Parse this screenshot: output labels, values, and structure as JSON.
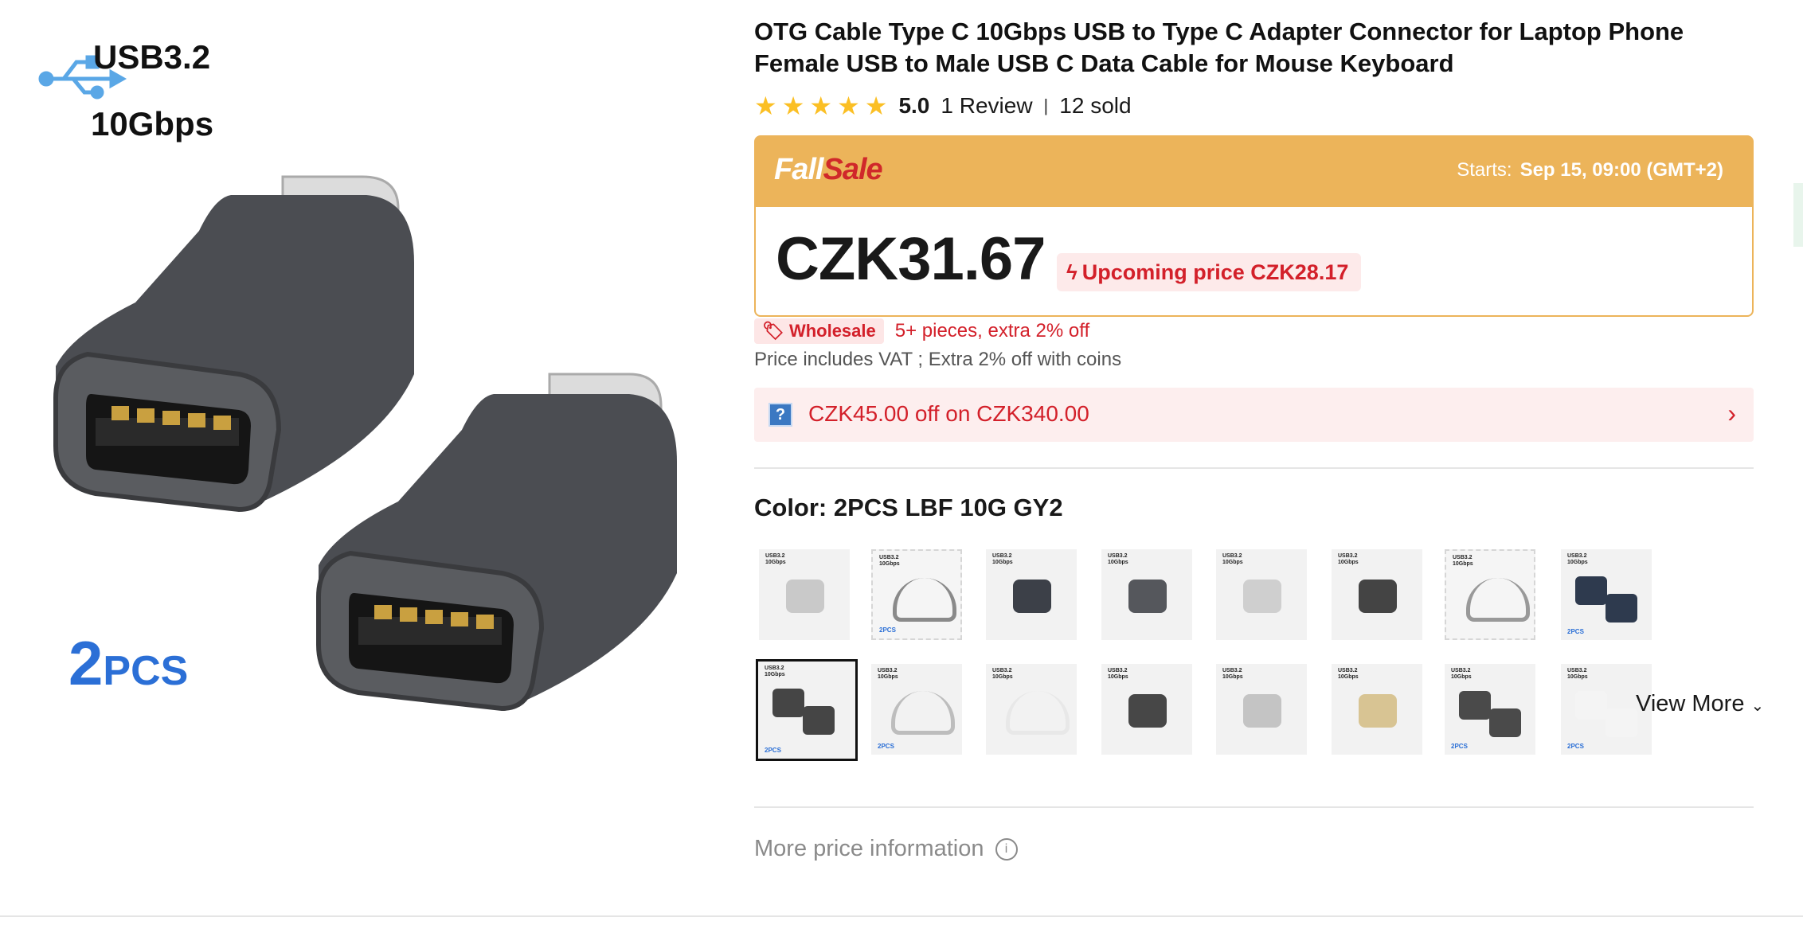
{
  "product_image": {
    "usb_label": "USB3.2",
    "speed_label": "10Gbps",
    "pack_number": "2",
    "pack_suffix": "PCS"
  },
  "title": "OTG Cable Type C 10Gbps USB to Type C Adapter Connector for Laptop Phone Female USB to Male USB C Data Cable for Mouse Keyboard",
  "rating": {
    "stars": 5,
    "score": "5.0",
    "reviews": "1 Review",
    "sold": "12 sold"
  },
  "sale": {
    "logo_part1": "Fall",
    "logo_part2": "Sale",
    "starts_label": "Starts:",
    "starts_value": "Sep 15, 09:00 (GMT+2)"
  },
  "price": {
    "main": "CZK31.67",
    "upcoming": "Upcoming price CZK28.17"
  },
  "wholesale": {
    "tag": "Wholesale",
    "text": "5+ pieces, extra 2% off"
  },
  "vat_text": "Price includes VAT ; Extra 2% off with coins",
  "coupon": {
    "icon": "?",
    "text": "CZK45.00 off on CZK340.00"
  },
  "color": {
    "label": "Color: 2PCS LBF 10G GY2",
    "thumbs_row1": [
      {
        "variant": "silver-adapter",
        "bottom": ""
      },
      {
        "variant": "gray-cable-2",
        "bottom": "2PCS"
      },
      {
        "variant": "dark-adapter-blue",
        "bottom": ""
      },
      {
        "variant": "gray-adapter-blue",
        "bottom": ""
      },
      {
        "variant": "silver-small",
        "bottom": ""
      },
      {
        "variant": "dark-adapter",
        "bottom": ""
      },
      {
        "variant": "gray-cable",
        "bottom": ""
      },
      {
        "variant": "navy-2",
        "bottom": "2PCS"
      }
    ],
    "thumbs_row2": [
      {
        "variant": "dark-2-selected",
        "bottom": "2PCS"
      },
      {
        "variant": "silver-cable-2",
        "bottom": "2PCS"
      },
      {
        "variant": "white-cable",
        "bottom": ""
      },
      {
        "variant": "dark-single",
        "bottom": ""
      },
      {
        "variant": "silver-single",
        "bottom": ""
      },
      {
        "variant": "gold-single",
        "bottom": ""
      },
      {
        "variant": "dark-2",
        "bottom": "2PCS"
      },
      {
        "variant": "white-2",
        "bottom": "2PCS"
      }
    ],
    "thumb_top_line1": "USB3.2",
    "thumb_top_line2": "10Gbps",
    "view_more": "View More"
  },
  "more_price": "More price information",
  "colors": {
    "sale_orange": "#ecb45a",
    "sale_red": "#d0282a",
    "accent_red": "#d3202a",
    "star_yellow": "#fbbf24",
    "pack_blue": "#2b6fd6"
  }
}
